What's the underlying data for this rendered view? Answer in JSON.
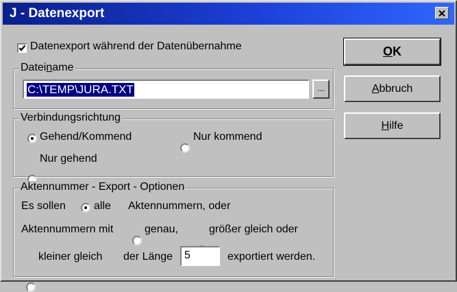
{
  "window": {
    "title": "J - Datenexport"
  },
  "export_checkbox": {
    "label": "Datenexport während der Datenübernahme",
    "checked": true
  },
  "filename_group": {
    "legend_pre": "Datei",
    "legend_u": "n",
    "legend_post": "ame",
    "value": "C:\\TEMP\\JURA.TXT",
    "browse_label": "..."
  },
  "direction_group": {
    "legend": "Verbindungsrichtung",
    "options": [
      {
        "label": "Gehend/Kommend",
        "selected": true
      },
      {
        "label": "Nur kommend",
        "selected": false
      },
      {
        "label": "Nur gehend",
        "selected": false
      }
    ]
  },
  "options_group": {
    "legend": "Aktennummer - Export - Optionen",
    "row1_prefix": "Es sollen",
    "opt_all": "alle",
    "row1_suffix": "Aktennummern, oder",
    "row2_prefix": "Aktennummern mit",
    "opt_exact": "genau,",
    "opt_greater": "größer gleich oder",
    "opt_less": "kleiner gleich",
    "length_prefix": "der Länge",
    "length_value": "5",
    "length_suffix": "exportiert werden."
  },
  "buttons": {
    "ok_u": "O",
    "ok_rest": "K",
    "cancel_u": "A",
    "cancel_rest": "bbruch",
    "help_u": "H",
    "help_rest": "ilfe"
  }
}
